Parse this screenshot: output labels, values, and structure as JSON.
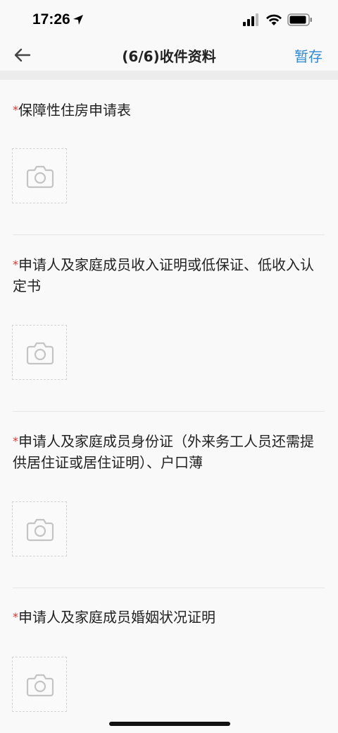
{
  "status_bar": {
    "time": "17:26"
  },
  "nav": {
    "title": "(6/6)收件资料",
    "save_label": "暂存"
  },
  "sections": [
    {
      "required_mark": "*",
      "title": "保障性住房申请表"
    },
    {
      "required_mark": "*",
      "title": "申请人及家庭成员收入证明或低保证、低收入认定书"
    },
    {
      "required_mark": "*",
      "title": "申请人及家庭成员身份证（外来务工人员还需提供居住证或居住证明）、户口薄"
    },
    {
      "required_mark": "*",
      "title": "申请人及家庭成员婚姻状况证明"
    }
  ],
  "icons": {
    "back": "arrow-left-icon",
    "upload": "camera-icon"
  },
  "colors": {
    "accent": "#2f8ad8",
    "required": "#e0322f",
    "background": "#f9f9f9"
  }
}
